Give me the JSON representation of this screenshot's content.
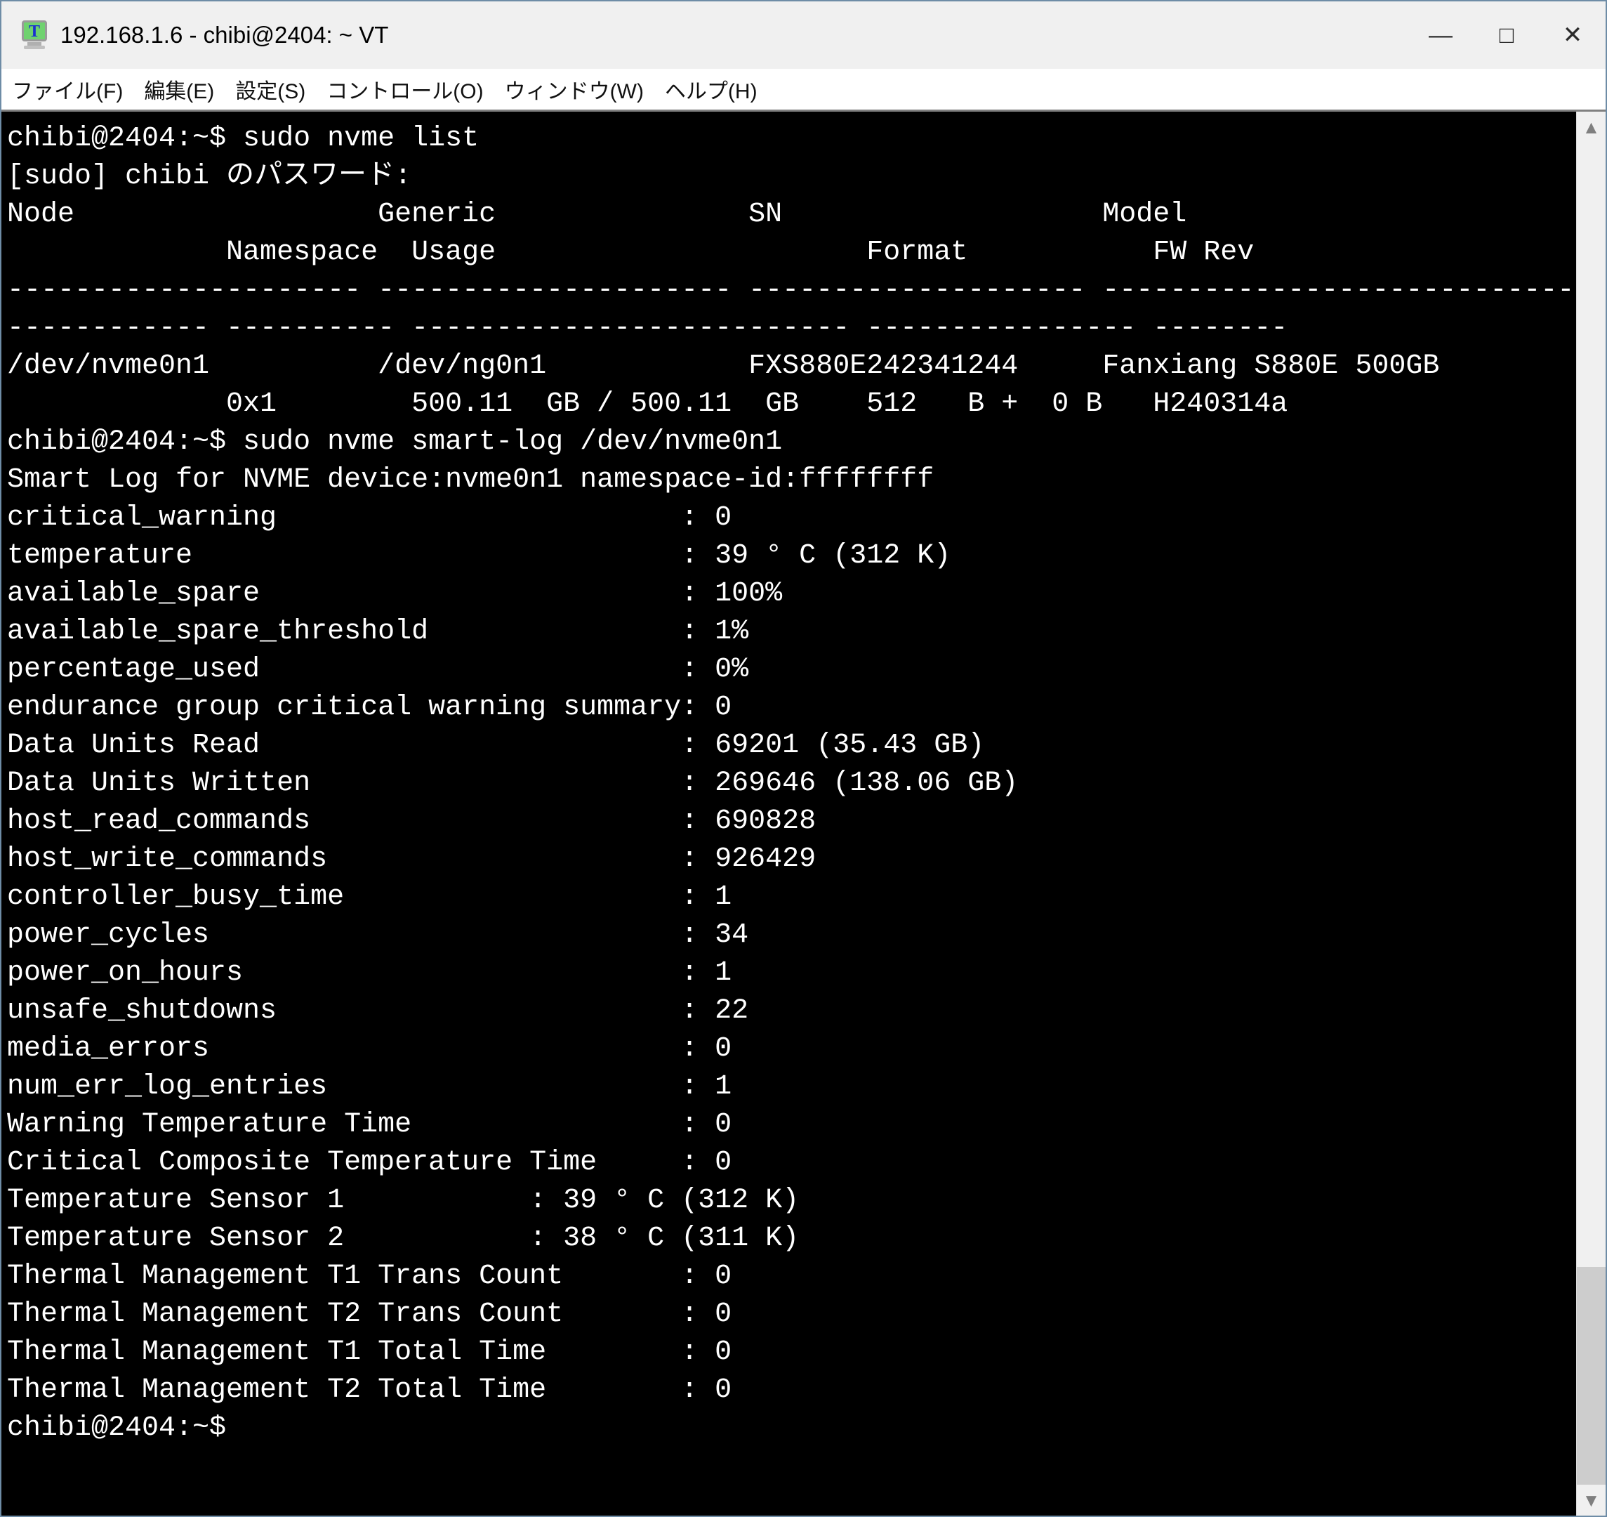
{
  "window": {
    "title": "192.168.1.6 - chibi@2404: ~ VT",
    "app_icon_letter": "T",
    "controls": {
      "minimize": "—",
      "maximize": "□",
      "close": "✕"
    }
  },
  "menu": {
    "items": [
      "ファイル(F)",
      "編集(E)",
      "設定(S)",
      "コントロール(O)",
      "ウィンドウ(W)",
      "ヘルプ(H)"
    ]
  },
  "terminal": {
    "columns": 93,
    "prompt": "chibi@2404:~$",
    "lines": [
      "chibi@2404:~$ sudo nvme list",
      "[sudo] chibi のパスワード:",
      "Node                  Generic               SN                   Model",
      "             Namespace  Usage                      Format           FW Rev",
      "--------------------- --------------------- -------------------- ----------------------------",
      "------------ ---------- -------------------------- ---------------- --------",
      "/dev/nvme0n1          /dev/ng0n1            FXS880E242341244     Fanxiang S880E 500GB",
      "             0x1        500.11  GB / 500.11  GB    512   B +  0 B   H240314a",
      "chibi@2404:~$ sudo nvme smart-log /dev/nvme0n1",
      "Smart Log for NVME device:nvme0n1 namespace-id:ffffffff",
      "critical_warning                        : 0",
      "temperature                             : 39 ° C (312 K)",
      "available_spare                         : 100%",
      "available_spare_threshold               : 1%",
      "percentage_used                         : 0%",
      "endurance group critical warning summary: 0",
      "Data Units Read                         : 69201 (35.43 GB)",
      "Data Units Written                      : 269646 (138.06 GB)",
      "host_read_commands                      : 690828",
      "host_write_commands                     : 926429",
      "controller_busy_time                    : 1",
      "power_cycles                            : 34",
      "power_on_hours                          : 1",
      "unsafe_shutdowns                        : 22",
      "media_errors                            : 0",
      "num_err_log_entries                     : 1",
      "Warning Temperature Time                : 0",
      "Critical Composite Temperature Time     : 0",
      "Temperature Sensor 1           : 39 ° C (312 K)",
      "Temperature Sensor 2           : 38 ° C (311 K)",
      "Thermal Management T1 Trans Count       : 0",
      "Thermal Management T2 Trans Count       : 0",
      "Thermal Management T1 Total Time        : 0",
      "Thermal Management T2 Total Time        : 0",
      "chibi@2404:~$ "
    ]
  },
  "scrollbar": {
    "up_arrow": "▲",
    "down_arrow": "▼"
  },
  "colors": {
    "terminal_bg": "#000000",
    "terminal_fg": "#ffffff",
    "titlebar_bg": "#f0f0f0",
    "menubar_bg": "#ffffff",
    "window_border": "#6e8ca6",
    "scrollbar_track": "#f0f0f0",
    "scrollbar_arrow": "#7f7f7f"
  }
}
